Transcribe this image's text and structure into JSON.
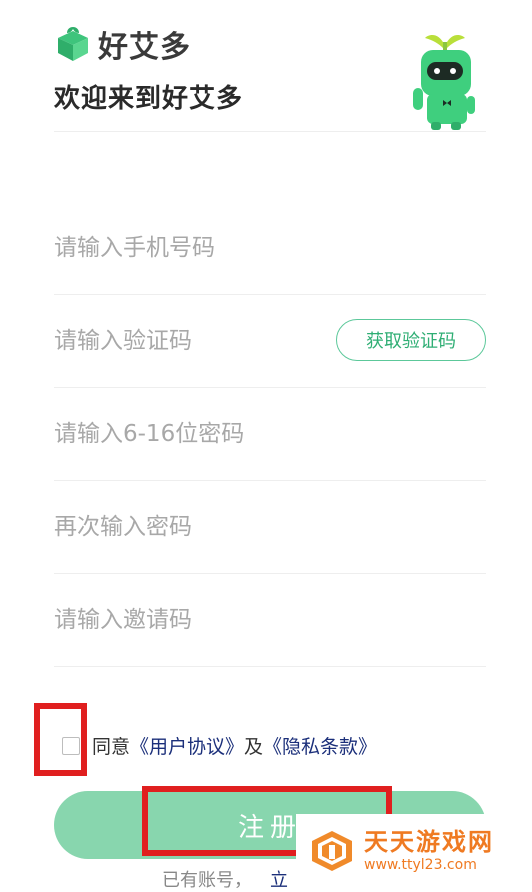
{
  "brand": {
    "name": "好艾多",
    "welcome": "欢迎来到好艾多"
  },
  "form": {
    "phone_placeholder": "请输入手机号码",
    "code_placeholder": "请输入验证码",
    "get_code_label": "获取验证码",
    "password_placeholder": "请输入6-16位密码",
    "confirm_placeholder": "再次输入密码",
    "invite_placeholder": "请输入邀请码"
  },
  "agreement": {
    "prefix": "同意",
    "user_agreement": "《用户协议》",
    "and": "及",
    "privacy": "《隐私条款》"
  },
  "register_label": "注册",
  "login_hint": {
    "text": "已有账号，",
    "link": "立"
  },
  "watermark": {
    "title": "天天游戏网",
    "url": "www.ttyl23.com"
  },
  "colors": {
    "accent": "#2fae74",
    "button": "#88d6ae",
    "highlight": "#e01f1f",
    "link": "#1b2f7a"
  }
}
